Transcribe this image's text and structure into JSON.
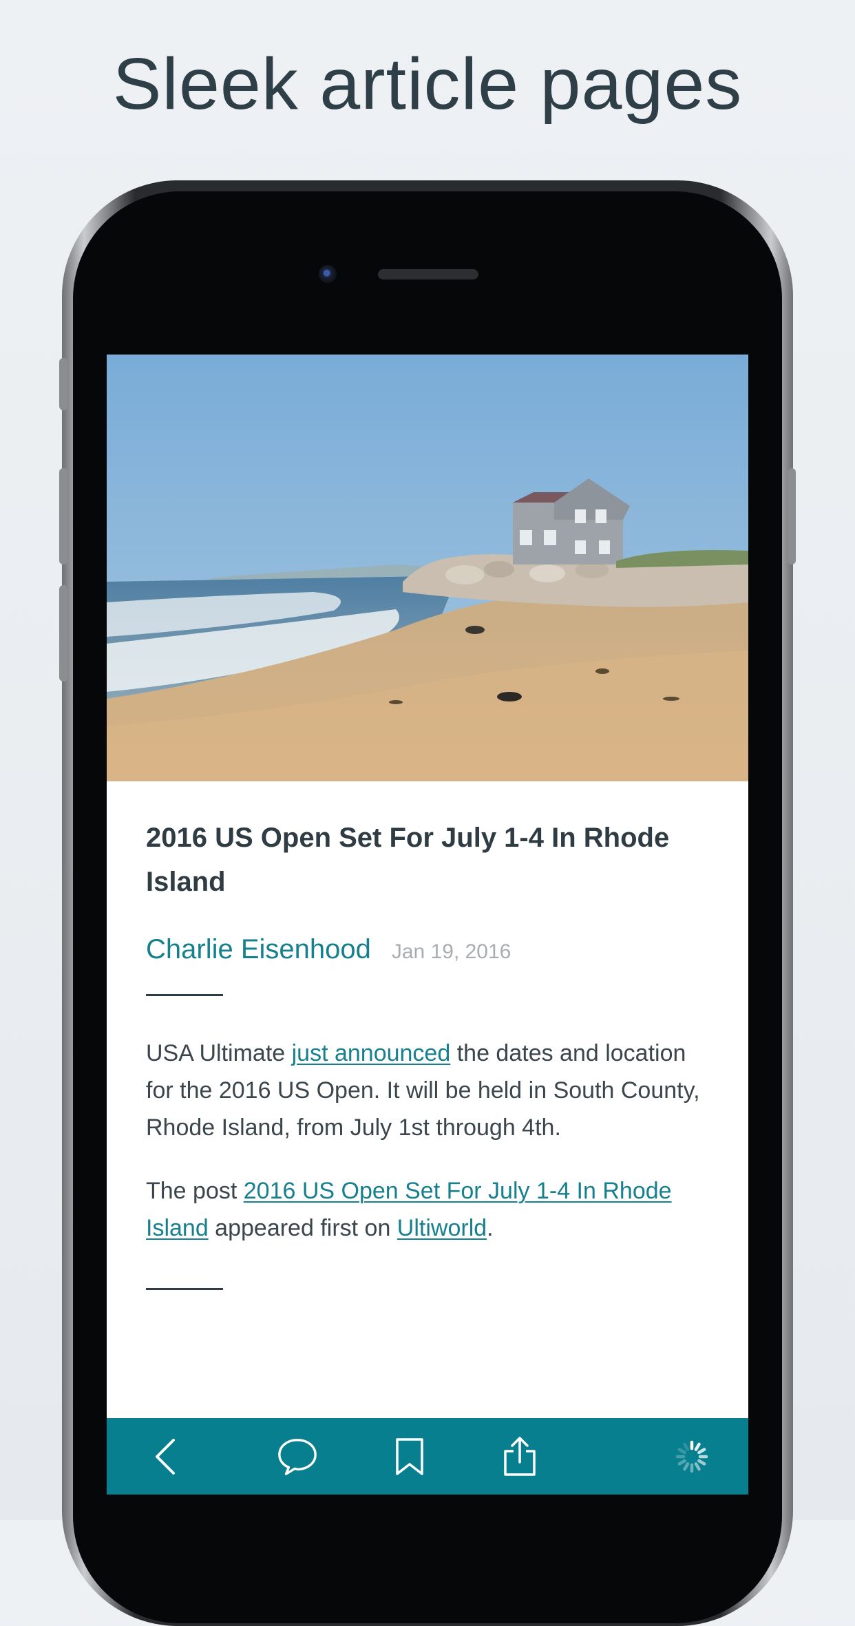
{
  "page": {
    "headline": "Sleek article pages"
  },
  "article": {
    "title": "2016 US Open Set For July 1-4 In Rhode Island",
    "author": "Charlie Eisenhood",
    "date": "Jan 19, 2016",
    "paragraph1": {
      "before_link": "USA Ultimate ",
      "link": "just announced",
      "after_link": " the dates and location for the 2016 US Open. It will be held in South County, Rhode Island, from July 1st through 4th."
    },
    "paragraph2": {
      "before_link": "The post ",
      "post_link": "2016 US Open Set For July 1-4 In Rhode Island",
      "middle": " appeared first on ",
      "site_link": "Ultiworld",
      "after": "."
    }
  },
  "toolbar": {
    "buttons": [
      {
        "name": "back",
        "icon": "chevron-left-icon"
      },
      {
        "name": "comments",
        "icon": "speech-bubble-icon"
      },
      {
        "name": "bookmark",
        "icon": "bookmark-icon"
      },
      {
        "name": "share",
        "icon": "share-icon"
      },
      {
        "name": "loading",
        "icon": "spinner-icon"
      }
    ]
  },
  "colors": {
    "accent": "#087f8f",
    "link": "#17808f",
    "text": "#2f3c43"
  }
}
